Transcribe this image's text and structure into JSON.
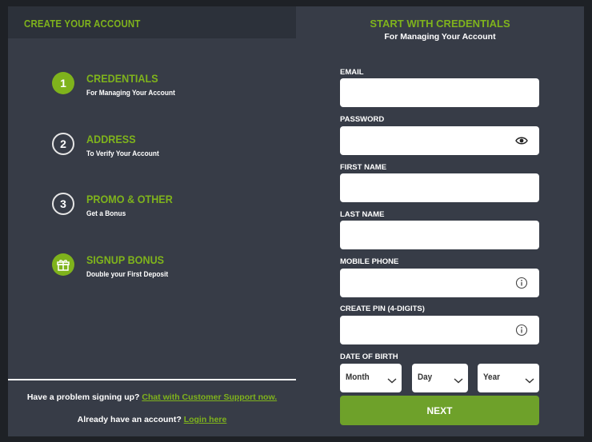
{
  "left": {
    "title": "CREATE YOUR ACCOUNT",
    "steps": [
      {
        "number": "1",
        "title": "CREDENTIALS",
        "subtitle": "For Managing Your Account",
        "icon": "step-number-active"
      },
      {
        "number": "2",
        "title": "ADDRESS",
        "subtitle": "To Verify Your Account",
        "icon": "step-number"
      },
      {
        "number": "3",
        "title": "PROMO & OTHER",
        "subtitle": "Get a Bonus",
        "icon": "step-number"
      },
      {
        "number": "",
        "title": "SIGNUP BONUS",
        "subtitle": "Double your First Deposit",
        "icon": "gift-icon"
      }
    ],
    "help_text": "Have a problem signing up?",
    "help_link": "Chat with Customer Support now.",
    "login_text": "Already have an account?",
    "login_link": "Login here"
  },
  "right": {
    "title": "START WITH CREDENTIALS",
    "subtitle": "For Managing Your Account",
    "fields": {
      "email": {
        "label": "EMAIL",
        "value": ""
      },
      "password": {
        "label": "PASSWORD",
        "value": "",
        "icon": "eye-icon"
      },
      "first_name": {
        "label": "FIRST NAME",
        "value": ""
      },
      "last_name": {
        "label": "LAST NAME",
        "value": ""
      },
      "mobile_phone": {
        "label": "MOBILE PHONE",
        "value": "",
        "icon": "info-icon"
      },
      "pin": {
        "label": "CREATE PIN (4-DIGITS)",
        "value": "",
        "icon": "info-icon"
      }
    },
    "dob": {
      "label": "DATE OF BIRTH",
      "month": "Month",
      "day": "Day",
      "year": "Year"
    },
    "next_label": "NEXT"
  },
  "colors": {
    "accent": "#7fb31c",
    "button": "#6ea12a",
    "panel": "#373c47",
    "background": "#1e2126"
  }
}
